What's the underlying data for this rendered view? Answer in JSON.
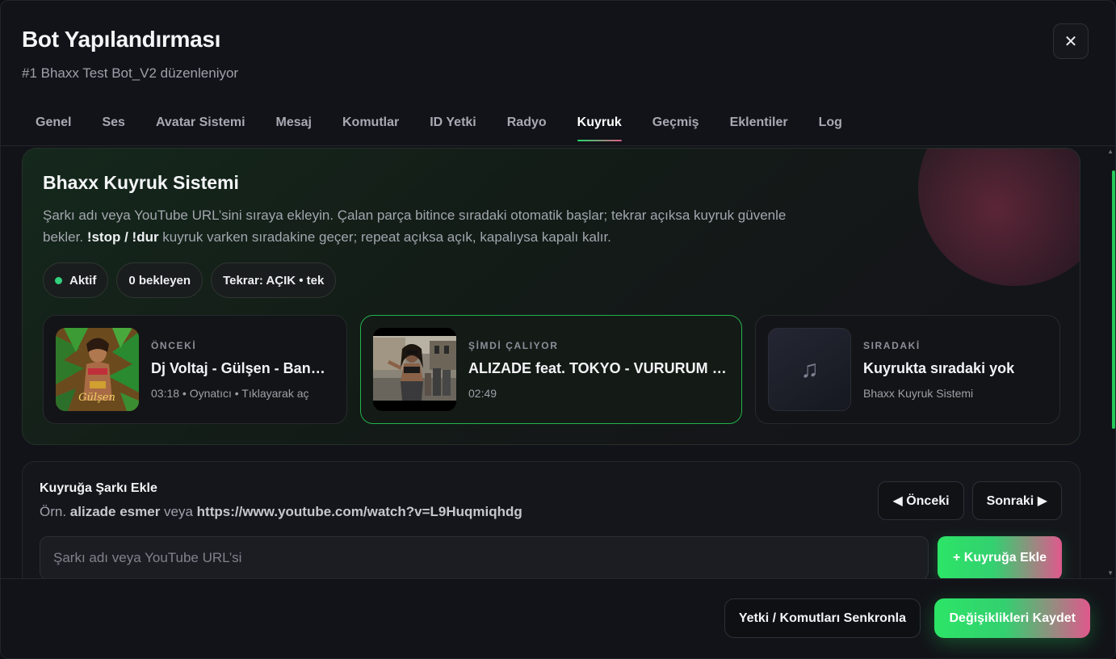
{
  "header": {
    "title": "Bot Yapılandırması",
    "subtitle": "#1 Bhaxx Test Bot_V2 düzenleniyor",
    "close_label": "✕"
  },
  "tabs": [
    {
      "label": "Genel",
      "active": false
    },
    {
      "label": "Ses",
      "active": false
    },
    {
      "label": "Avatar Sistemi",
      "active": false
    },
    {
      "label": "Mesaj",
      "active": false
    },
    {
      "label": "Komutlar",
      "active": false
    },
    {
      "label": "ID Yetki",
      "active": false
    },
    {
      "label": "Radyo",
      "active": false
    },
    {
      "label": "Kuyruk",
      "active": true
    },
    {
      "label": "Geçmiş",
      "active": false
    },
    {
      "label": "Eklentiler",
      "active": false
    },
    {
      "label": "Log",
      "active": false
    }
  ],
  "queue": {
    "title": "Bhaxx Kuyruk Sistemi",
    "description_part1": "Şarkı adı veya YouTube URL’sini sıraya ekleyin. Çalan parça bitince sıradaki otomatik başlar; tekrar açıksa kuyruk güvenle bekler. ",
    "description_bold": "!stop / !dur",
    "description_part2": " kuyruk varken sıradakine geçer; repeat açıksa açık, kapalıysa kapalı kalır.",
    "pills": {
      "status": "Aktif",
      "waiting": "0 bekleyen",
      "repeat": "Tekrar: AÇIK • tek"
    },
    "previous": {
      "label": "ÖNCEKİ",
      "title": "Dj Voltaj - Gülşen - Bangır Bangır (Remix)",
      "meta": "03:18 • Oynatıcı • Tıklayarak aç"
    },
    "current": {
      "label": "ŞİMDİ ÇALIYOR",
      "title": "ALIZADE feat. TOKYO - VURURUM (Official Video)",
      "meta": "02:49"
    },
    "next": {
      "label": "SIRADAKİ",
      "title": "Kuyrukta sıradaki yok",
      "meta": "Bhaxx Kuyruk Sistemi",
      "icon": "music-note-icon"
    }
  },
  "add_song": {
    "title": "Kuyruğa Şarkı Ekle",
    "example_prefix": "Örn. ",
    "example_query": "alizade esmer",
    "example_mid": " veya ",
    "example_url": "https://www.youtube.com/watch?v=L9Huqmiqhdg",
    "prev_button": "◀ Önceki",
    "next_button": "Sonraki ▶",
    "input_placeholder": "Şarkı adı veya YouTube URL’si",
    "input_value": "",
    "add_button": "+ Kuyruğa Ekle"
  },
  "footer": {
    "sync_button": "Yetki / Komutları Senkronla",
    "save_button": "Değişiklikleri Kaydet"
  },
  "colors": {
    "accent_green": "#2ce566",
    "accent_pink": "#e0588c",
    "status_dot": "#33d07d"
  }
}
